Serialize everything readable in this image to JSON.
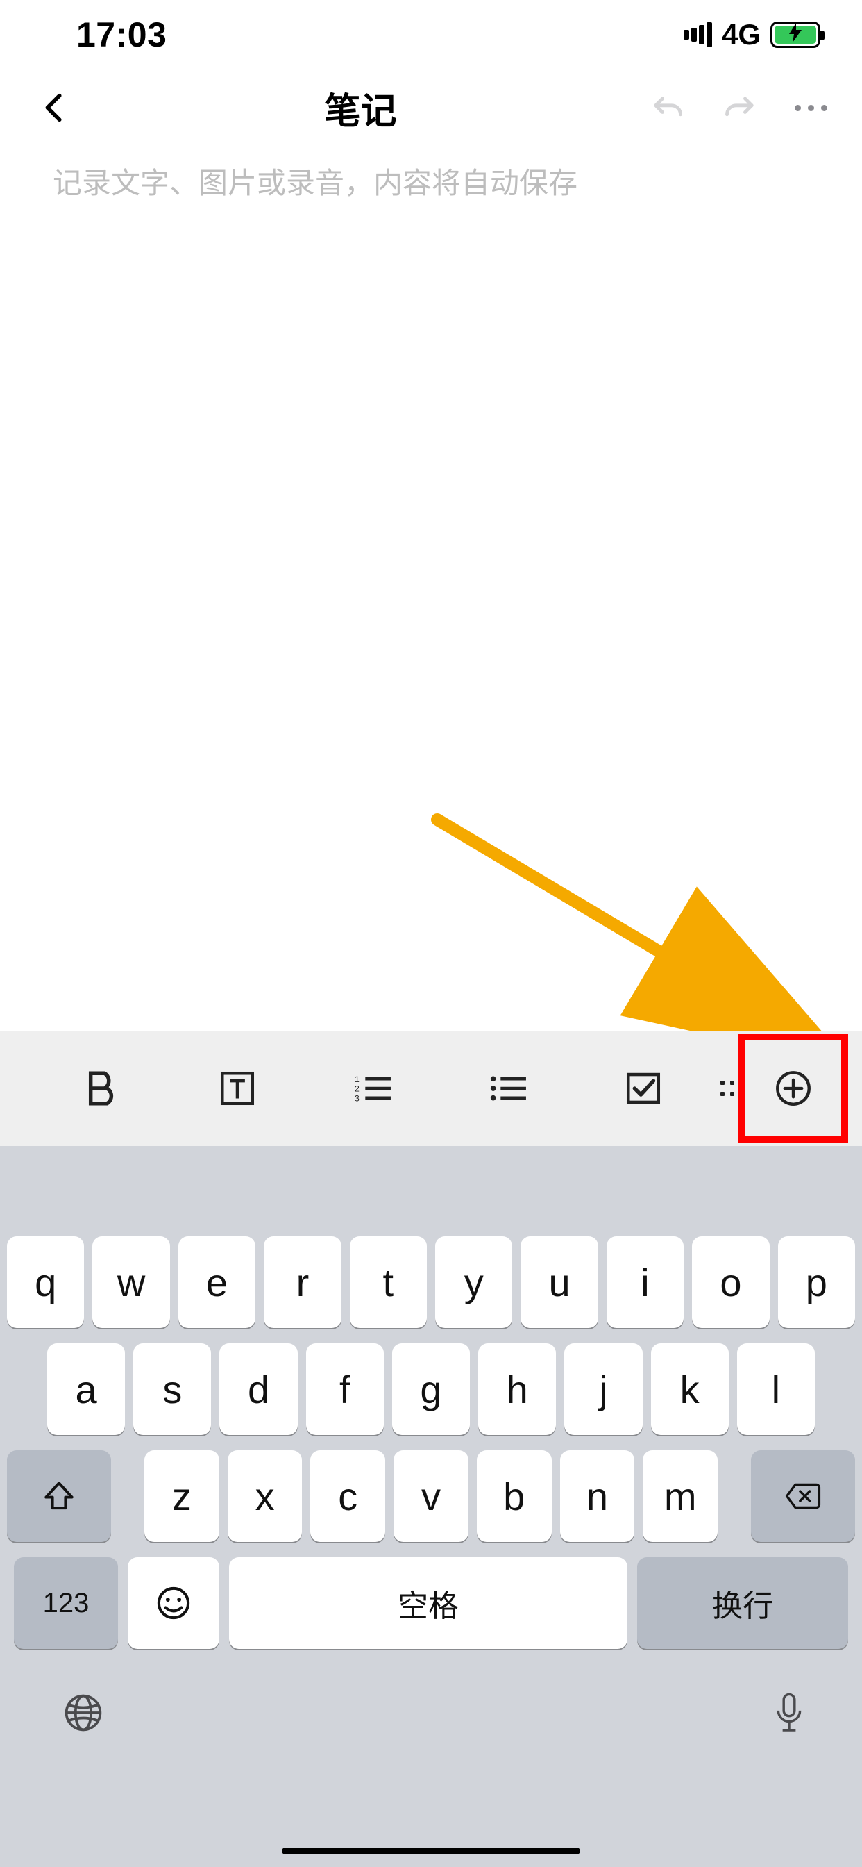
{
  "status": {
    "time": "17:03",
    "network": "4G"
  },
  "nav": {
    "title": "笔记"
  },
  "editor": {
    "placeholder": "记录文字、图片或录音，内容将自动保存"
  },
  "keyboard": {
    "row1": [
      "q",
      "w",
      "e",
      "r",
      "t",
      "y",
      "u",
      "i",
      "o",
      "p"
    ],
    "row2": [
      "a",
      "s",
      "d",
      "f",
      "g",
      "h",
      "j",
      "k",
      "l"
    ],
    "row3": [
      "z",
      "x",
      "c",
      "v",
      "b",
      "n",
      "m"
    ],
    "numKey": "123",
    "space": "空格",
    "return": "换行"
  }
}
